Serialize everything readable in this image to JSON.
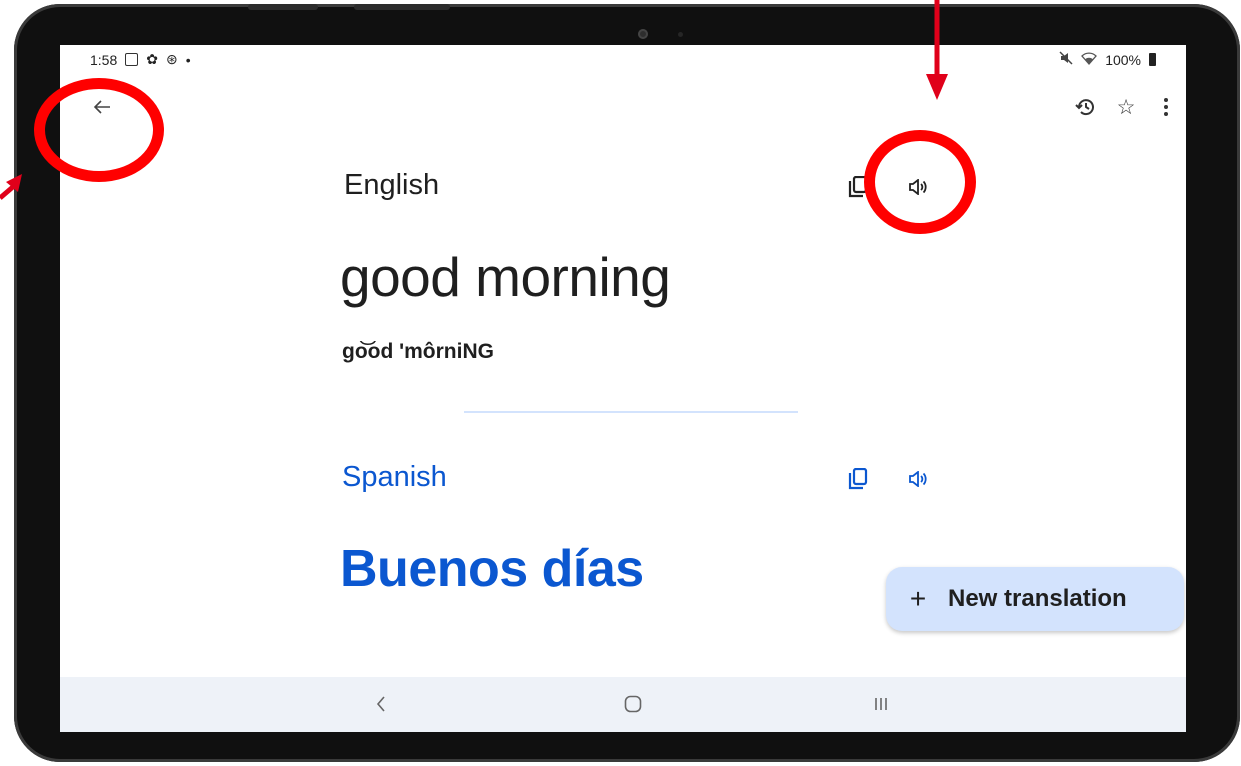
{
  "status_bar": {
    "time": "1:58",
    "dot": "•",
    "battery": "100%",
    "icons": [
      "gallery-icon",
      "settings-icon",
      "app-icon",
      "mute-icon",
      "wifi-icon",
      "battery-icon"
    ]
  },
  "app_bar": {
    "back_icon": "back-arrow-icon",
    "actions": [
      "history-icon",
      "star-icon",
      "more-vert-icon"
    ]
  },
  "source": {
    "language": "English",
    "text": "good morning",
    "phonetic": "go͝od 'môrniNG",
    "icons": [
      "copy-icon",
      "speaker-icon"
    ]
  },
  "target": {
    "language": "Spanish",
    "text": "Buenos días",
    "icons": [
      "copy-icon",
      "speaker-icon"
    ]
  },
  "fab": {
    "icon": "+",
    "label": "New translation"
  },
  "nav_bar": {
    "icons": [
      "back-nav-icon",
      "home-nav-icon",
      "recents-nav-icon"
    ]
  },
  "annotations": {
    "color": "#ff0000",
    "marks": [
      "circle-around-back-button",
      "circle-around-speaker-button",
      "arrow-to-back-button",
      "arrow-to-speaker-button"
    ]
  },
  "colors": {
    "accent": "#0b57d0",
    "fab_bg": "#d3e3fd",
    "nav_bg": "#eef2f8"
  }
}
